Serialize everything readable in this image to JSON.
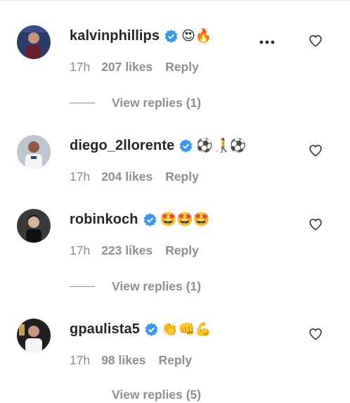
{
  "comments": [
    {
      "username": "kalvinphillips",
      "emojis": "😍🔥",
      "time": "17h",
      "likes": "207 likes",
      "reply": "Reply",
      "view_replies": "View replies (1)"
    },
    {
      "username": "diego_2llorente",
      "emojis": "⚽🧑‍🦯⚽",
      "time": "17h",
      "likes": "204 likes",
      "reply": "Reply"
    },
    {
      "username": "robinkoch",
      "emojis": "🤩🤩🤩",
      "time": "17h",
      "likes": "223 likes",
      "reply": "Reply",
      "view_replies": "View replies (1)"
    },
    {
      "username": "gpaulista5",
      "emojis": "👏👊💪",
      "time": "17h",
      "likes": "98 likes",
      "reply": "Reply",
      "view_replies": "View replies (5)"
    }
  ],
  "icons": {
    "verified": "verified-badge-icon",
    "heart": "heart-outline-icon",
    "more": "more-options-icon"
  },
  "colors": {
    "verified": "#3897f0",
    "muted": "#8e8e8e",
    "text": "#262626"
  }
}
